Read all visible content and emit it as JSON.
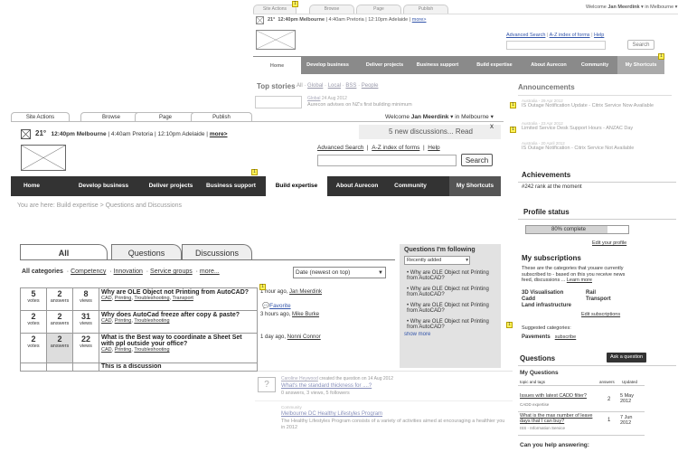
{
  "bg": {
    "tabs": [
      "Site Actions",
      "Browse",
      "Page",
      "Publish"
    ],
    "welcome_prefix": "Welcome",
    "user": "Jan Meerdink",
    "location": "in Melbourne",
    "weather": {
      "temp": "21°",
      "melbourne": "12:40pm Melbourne",
      "pretoria": "4:40am Pretoria",
      "adelaide": "12:10pm Adelaide",
      "more": "more>"
    },
    "links": {
      "advanced": "Advanced Search",
      "az": "A-Z index of forms",
      "help": "Help"
    },
    "search_btn": "Search",
    "nav": [
      "Home",
      "Develop business",
      "Deliver projects",
      "Business support",
      "Build expertise",
      "About Aurecon",
      "Community",
      "My Shortcuts"
    ],
    "top_stories": {
      "label": "Top stories",
      "filters": [
        "All",
        "Global",
        "Local",
        "BSS",
        "People"
      ]
    },
    "story": {
      "tag": "Global",
      "date": "24 Aug 2012",
      "headline": "Aurecon advises on NZ's first building minimum"
    },
    "announcements": {
      "title": "Announcements",
      "items": [
        {
          "meta": "Australia - 29 Apr 2012",
          "text": "IS Outage Notification Update - Citrix Service Now Available"
        },
        {
          "meta": "Australia - 23 Apr 2012",
          "text": "Limited Service Desk Support Hours - ANZAC Day"
        },
        {
          "meta": "Australia - 20 April 2012",
          "text": "IS Outage Notification - Citrix Service Not Available"
        }
      ]
    }
  },
  "front": {
    "tabs": [
      "Site Actions",
      "Browse",
      "Page",
      "Publish"
    ],
    "welcome_prefix": "Welcome",
    "user": "Jan Meerdink",
    "location": "in Melbourne",
    "weather": {
      "temp": "21°",
      "melbourne": "12:40pm Melbourne",
      "pretoria": "4:40am Pretoria",
      "adelaide": "12:10pm Adelaide",
      "more": "more>"
    },
    "discussions_banner": "5 new discussions... Read",
    "close": "x",
    "links": {
      "advanced": "Advanced Search",
      "az": "A-Z index of forms",
      "help": "Help"
    },
    "search_btn": "Search",
    "nav": [
      "Home",
      "Develop business",
      "Deliver projects",
      "Business support",
      "Build expertise",
      "About Aurecon",
      "Community",
      "My Shortcuts"
    ],
    "breadcrumb": "You are here: Build expertise > Questions and Discussions",
    "content_tabs": [
      "All",
      "Questions",
      "Discussions"
    ],
    "categories": {
      "label": "All categories",
      "items": [
        "Competency",
        "Innovation",
        "Service groups",
        "more..."
      ]
    },
    "sort": "Date (newest on top)",
    "questions": [
      {
        "votes": "5",
        "votes_label": "votes",
        "answers": "2",
        "answers_label": "answers",
        "views": "8",
        "views_label": "views",
        "title": "Why are OLE Object not Printing from AutoCAD?",
        "tags": [
          "CAD",
          "Printing",
          "Troubleshooting",
          "Transport"
        ],
        "time": "1 hour ago,",
        "author": "Jan Meerdink",
        "favorite": "Favorite"
      },
      {
        "votes": "2",
        "votes_label": "votes",
        "answers": "2",
        "answers_label": "answers",
        "views": "31",
        "views_label": "views",
        "title": "Why does AutoCad freeze after copy & paste?",
        "tags": [
          "CAD",
          "Printing",
          "Troubleshooting"
        ],
        "time": "3 hours ago,",
        "author": "Mike Burke"
      },
      {
        "votes": "2",
        "votes_label": "votes",
        "answers": "2",
        "answers_label": "answers",
        "views": "22",
        "views_label": "views",
        "title": "What is the Best way to coordinate a Sheet Set with ppl outside your office?",
        "tags": [
          "CAD",
          "Printing",
          "Troubleshooting"
        ],
        "time": "1 day ago,",
        "author": "Nonni Connor"
      },
      {
        "title": "This is a discussion"
      }
    ],
    "following": {
      "title": "Questions I'm following",
      "filter": "Recently added",
      "items": [
        "Why are OLE Object not Printing from AutoCAD?",
        "Why are OLE Object not Printing from AutoCAD?",
        "Why are OLE Object not Printing from AutoCAD?",
        "Why are OLE Object not Printing from AutoCAD?"
      ],
      "more": "show more"
    }
  },
  "bottom": {
    "item1": {
      "meta_user": "Caroline Heywood",
      "meta_rest": "created the question on 14 Aug 2012",
      "title": "What's the standard thickness for ....?",
      "stats": "0 answers, 3 views, 5 followers"
    },
    "item2": {
      "meta": "Community",
      "title": "Melbourne DC Healthy Lifestyles Program",
      "text": "The Healthy Lifestyles Program consists of a variety of activities aimed at encouraging a healthier you in 2012"
    }
  },
  "side": {
    "achievements": {
      "title": "Achievements",
      "text": "#242 rank at the moment"
    },
    "profile": {
      "title": "Profile status",
      "progress": 0.8,
      "progress_label": "80% complete",
      "edit": "Edit your profile"
    },
    "subscriptions": {
      "title": "My subscriptions",
      "desc": "These are the categories that youare currently subscribed to - based on this you receive news feed, discussions ...",
      "learn": "Learn more",
      "items": [
        "3D Visualisation",
        "Rail",
        "Cadd",
        "Transport",
        "Land infrastructure"
      ],
      "edit": "Edit subscriptions",
      "suggested_label": "Suggested categories:",
      "suggested": "Pavements",
      "subscribe": "subscribe"
    },
    "questions": {
      "title": "Questions",
      "ask": "Ask a question",
      "my": "My Questions",
      "col1": "topic and tags",
      "col2": "answers",
      "col3": "Updated",
      "rows": [
        {
          "title": "Issues with latest CADD filter?",
          "tag": "CADD expertise",
          "answers": "2",
          "updated": "5 May 2012"
        },
        {
          "title": "What is the max number of leave days that I can buy?",
          "tag": "ISS - Information Service",
          "answers": "1",
          "updated": "7 Jun 2012"
        }
      ],
      "can_help": "Can you help answering:"
    }
  }
}
